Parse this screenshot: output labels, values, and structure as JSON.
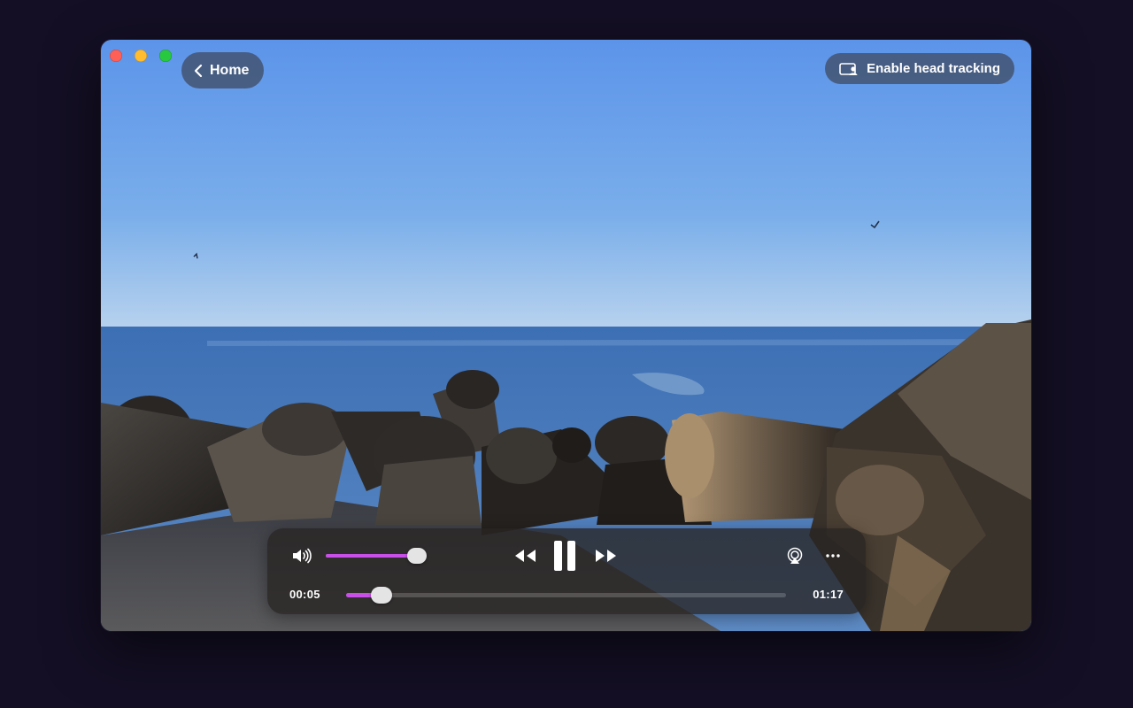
{
  "header": {
    "home_label": "Home",
    "head_tracking_label": "Enable head tracking"
  },
  "traffic_lights": {
    "close_color": "#fe5f57",
    "minimize_color": "#febc2e",
    "zoom_color": "#28c840"
  },
  "player": {
    "accent_color": "#c850e8",
    "current_time": "00:05",
    "total_time": "01:17",
    "progress": 0.08,
    "volume": 0.9,
    "state": "playing",
    "icons": {
      "volume": "speaker-icon",
      "rewind": "rewind-icon",
      "pause": "pause-icon",
      "forward": "fast-forward-icon",
      "airplay": "airplay-icon",
      "more": "more-icon"
    }
  }
}
